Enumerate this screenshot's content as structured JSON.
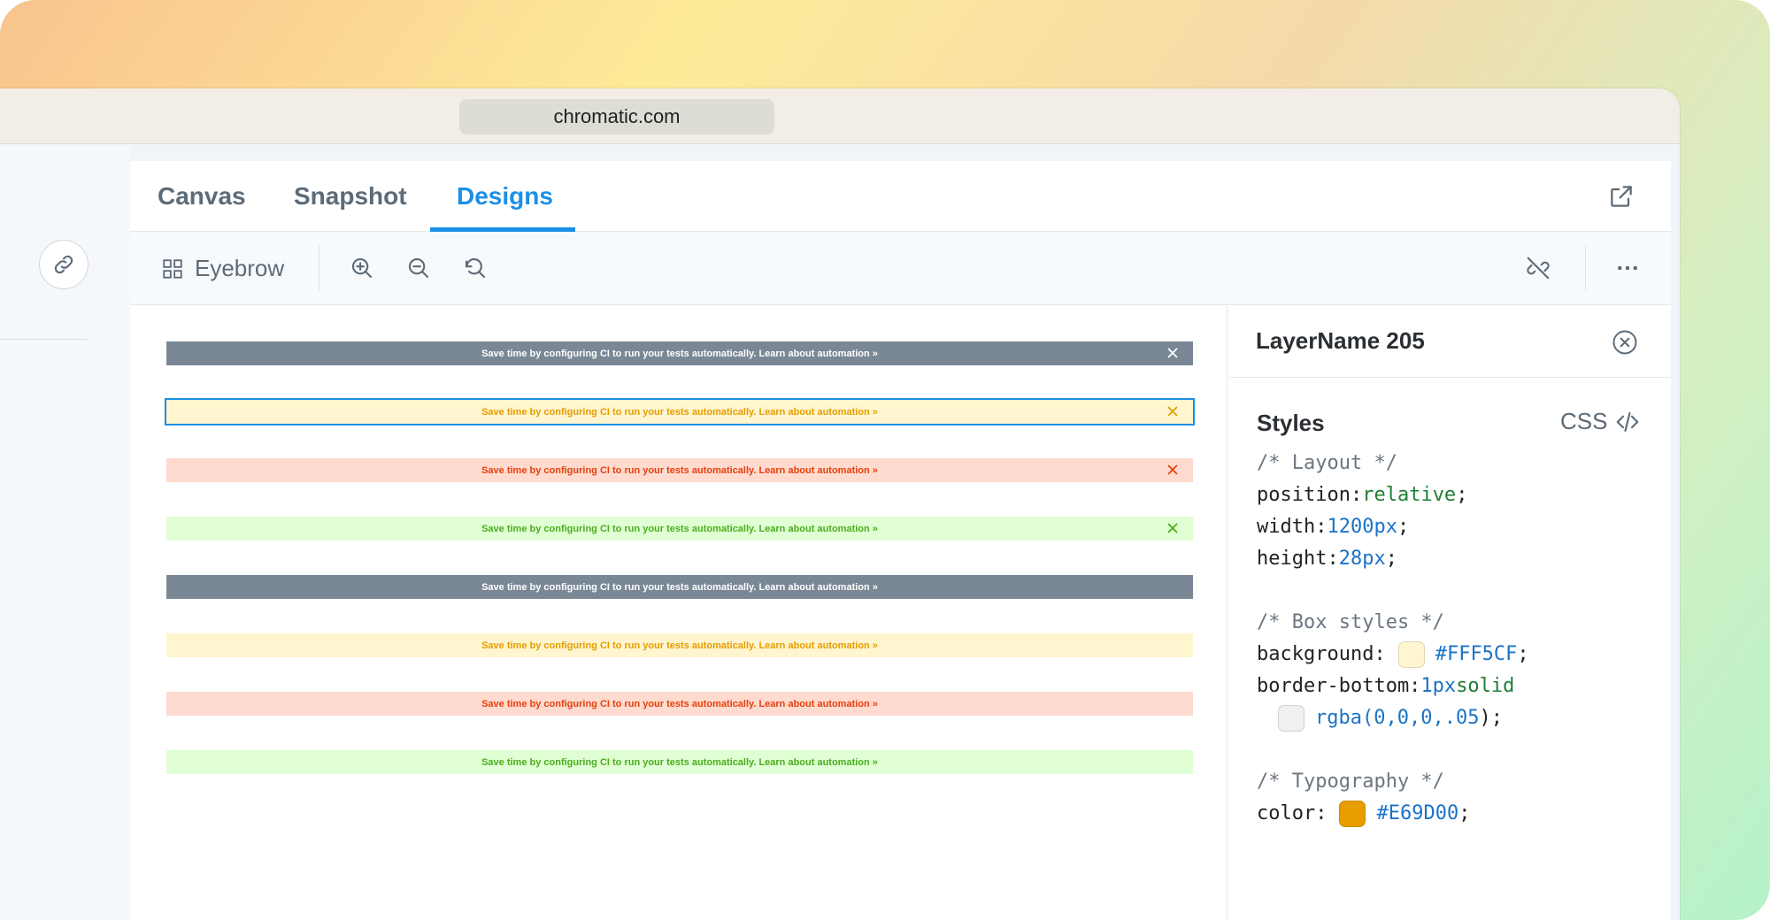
{
  "browser": {
    "url": "chromatic.com"
  },
  "tabs": [
    {
      "label": "Canvas",
      "active": false
    },
    {
      "label": "Snapshot",
      "active": false
    },
    {
      "label": "Designs",
      "active": true
    }
  ],
  "toolbar": {
    "component_label": "Eyebrow",
    "icons": [
      "grid-icon",
      "zoom-in-icon",
      "zoom-out-icon",
      "zoom-reset-icon",
      "unlink-icon",
      "more-icon",
      "open-external-icon"
    ]
  },
  "banners": [
    {
      "text": "Save time by configuring CI to run your tests automatically. Learn about automation »",
      "bg": "#7a8896",
      "fg": "#ffffff",
      "closable": true,
      "selected": false
    },
    {
      "text": "Save time by configuring CI to run your tests automatically. Learn about automation »",
      "bg": "#fff5cf",
      "fg": "#e69d00",
      "closable": true,
      "selected": true
    },
    {
      "text": "Save time by configuring CI to run your tests automatically. Learn about automation »",
      "bg": "#fedacf",
      "fg": "#e6400c",
      "closable": true,
      "selected": false
    },
    {
      "text": "Save time by configuring CI to run your tests automatically. Learn about automation »",
      "bg": "#e1ffd4",
      "fg": "#4aae1e",
      "closable": true,
      "selected": false
    },
    {
      "text": "Save time by configuring CI to run your tests automatically. Learn about automation »",
      "bg": "#7a8896",
      "fg": "#ffffff",
      "closable": false,
      "selected": false
    },
    {
      "text": "Save time by configuring CI to run your tests automatically. Learn about automation »",
      "bg": "#fff5cf",
      "fg": "#e69d00",
      "closable": false,
      "selected": false
    },
    {
      "text": "Save time by configuring CI to run your tests automatically. Learn about automation »",
      "bg": "#fedacf",
      "fg": "#e6400c",
      "closable": false,
      "selected": false
    },
    {
      "text": "Save time by configuring CI to run your tests automatically. Learn about automation »",
      "bg": "#e1ffd4",
      "fg": "#4aae1e",
      "closable": false,
      "selected": false
    }
  ],
  "inspector": {
    "layer_name": "LayerName 205",
    "styles_title": "Styles",
    "css_label": "CSS",
    "code": {
      "layout_comment": "/* Layout */",
      "position_prop": "position:",
      "position_val": "relative",
      "width_prop": "width:",
      "width_val": "1200px",
      "height_prop": "height:",
      "height_val": "28px",
      "box_comment": "/* Box styles */",
      "background_prop": "background:",
      "background_val": "#FFF5CF",
      "border_prop": "border-bottom:",
      "border_width": "1px",
      "border_style": "solid",
      "border_color_fn": "rgba(",
      "border_color_args": "0,0,0,.05",
      "border_color_end": ");",
      "typo_comment": "/* Typography */",
      "color_prop": "color:",
      "color_val": "#E69D00",
      "semicolon": ";"
    },
    "swatches": {
      "background": "#FFF5CF",
      "border": "#f0f0f0",
      "color": "#E69D00"
    }
  },
  "colors": {
    "accent": "#1b8fe6",
    "selection_outline": "#1b8fe6"
  }
}
